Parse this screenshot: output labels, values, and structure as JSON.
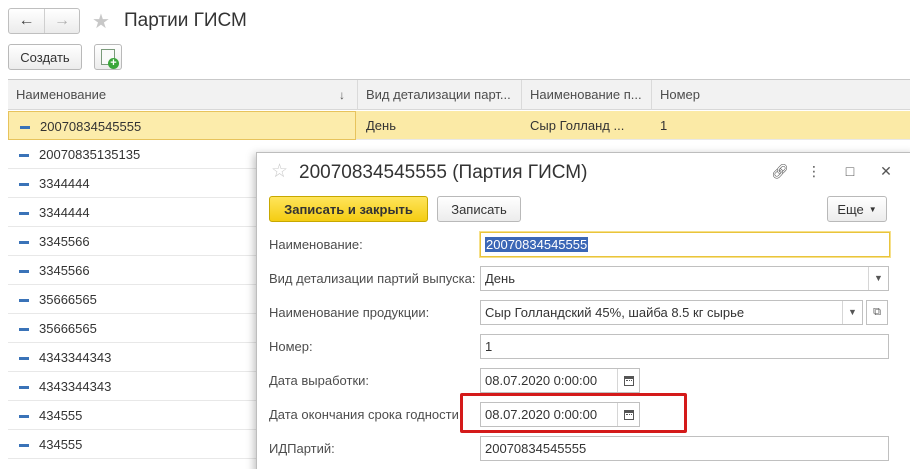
{
  "header": {
    "back_icon": "arrow-left-icon",
    "forward_icon": "arrow-right-icon",
    "star_icon": "star-icon",
    "title": "Партии ГИСМ"
  },
  "toolbar": {
    "create_label": "Создать",
    "add_icon": "add-document-icon"
  },
  "table": {
    "columns": [
      {
        "label": "Наименование"
      },
      {
        "label": "Вид детализации парт..."
      },
      {
        "label": "Наименование п..."
      },
      {
        "label": "Номер"
      }
    ],
    "sort_indicator": "↓",
    "rows": [
      {
        "name": "20070834545555",
        "detail": "День",
        "product": "Сыр  Голланд  ...",
        "number": "1"
      },
      {
        "name": "20070835135135",
        "detail": "",
        "product": "",
        "number": ""
      },
      {
        "name": "3344444",
        "detail": "",
        "product": "",
        "number": ""
      },
      {
        "name": "3344444",
        "detail": "",
        "product": "",
        "number": ""
      },
      {
        "name": "3345566",
        "detail": "",
        "product": "",
        "number": ""
      },
      {
        "name": "3345566",
        "detail": "",
        "product": "",
        "number": ""
      },
      {
        "name": "35666565",
        "detail": "",
        "product": "",
        "number": ""
      },
      {
        "name": "35666565",
        "detail": "",
        "product": "",
        "number": ""
      },
      {
        "name": "4343344343",
        "detail": "",
        "product": "",
        "number": ""
      },
      {
        "name": "4343344343",
        "detail": "",
        "product": "",
        "number": ""
      },
      {
        "name": "434555",
        "detail": "",
        "product": "",
        "number": ""
      },
      {
        "name": "434555",
        "detail": "",
        "product": "",
        "number": ""
      }
    ]
  },
  "dialog": {
    "title": "20070834545555 (Партия ГИСМ)",
    "star_icon": "star-icon",
    "window_icons": [
      "link-icon",
      "more-vertical-icon",
      "maximize-icon",
      "close-icon"
    ],
    "write_close_label": "Записать и закрыть",
    "write_label": "Записать",
    "more_label": "Еще",
    "fields": {
      "name_label": "Наименование:",
      "name_value": "20070834545555",
      "detail_label": "Вид детализации партий выпуска:",
      "detail_value": "День",
      "product_label": "Наименование продукции:",
      "product_value": "Сыр Голландский 45%, шайба 8.5 кг сырье",
      "number_label": "Номер:",
      "number_value": "1",
      "prod_date_label": "Дата выработки:",
      "prod_date_value": "08.07.2020  0:00:00",
      "expiry_label": "Дата окончания срока годности:",
      "expiry_value": "08.07.2020  0:00:00",
      "id_label": "ИДПартий:",
      "id_value": "20070834545555"
    }
  },
  "colors": {
    "accent_yellow": "#f4cd12",
    "selection_row": "#fbeaa6",
    "highlight_red": "#d41a1a"
  }
}
